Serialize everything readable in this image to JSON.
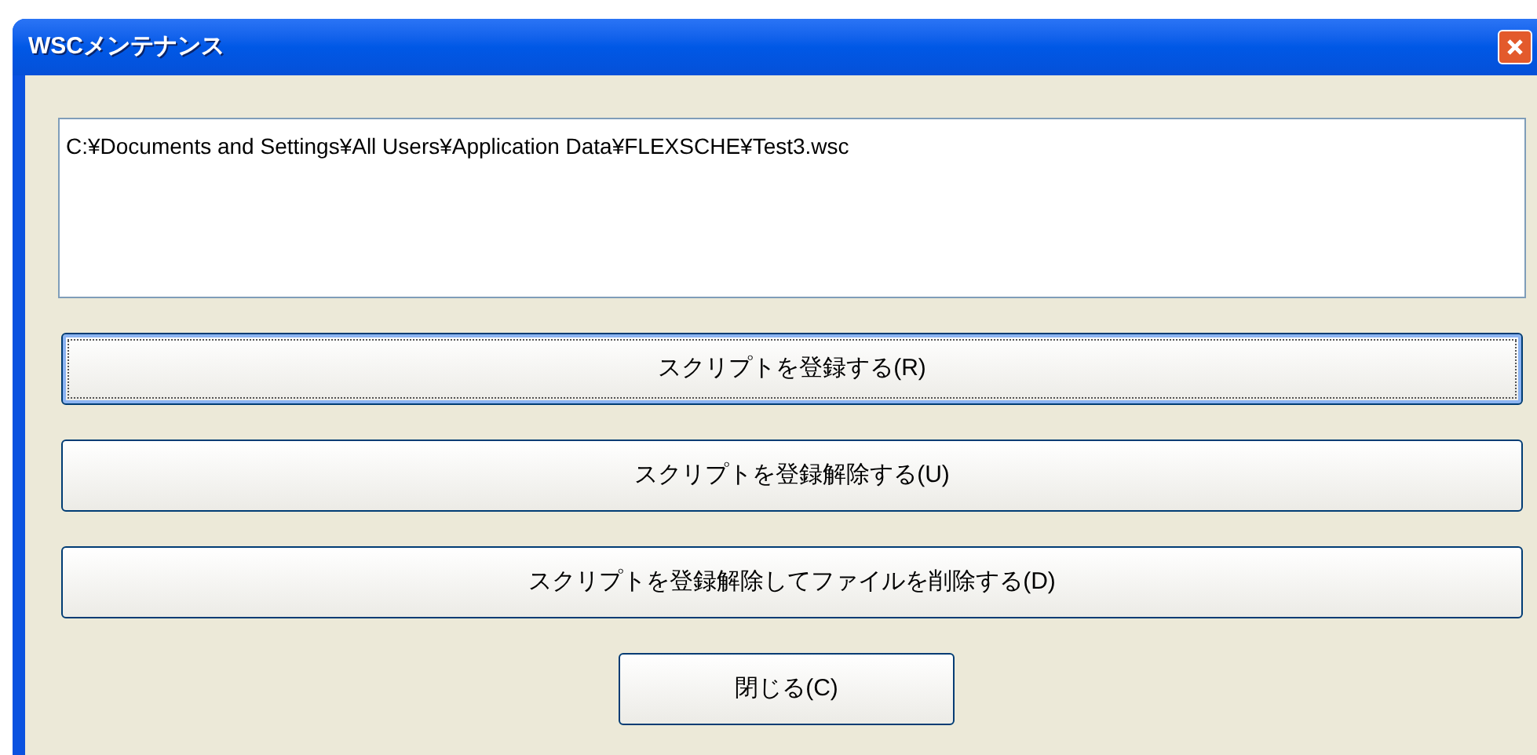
{
  "window": {
    "title": "WSCメンテナンス"
  },
  "path_box": {
    "value": "C:¥Documents and Settings¥All Users¥Application Data¥FLEXSCHE¥Test3.wsc"
  },
  "buttons": [
    {
      "label": "スクリプトを登録する(R)",
      "focused": true
    },
    {
      "label": "スクリプトを登録解除する(U)",
      "focused": false
    },
    {
      "label": "スクリプトを登録解除してファイルを削除する(D)",
      "focused": false
    }
  ],
  "close_button": {
    "label": "閉じる(C)"
  }
}
